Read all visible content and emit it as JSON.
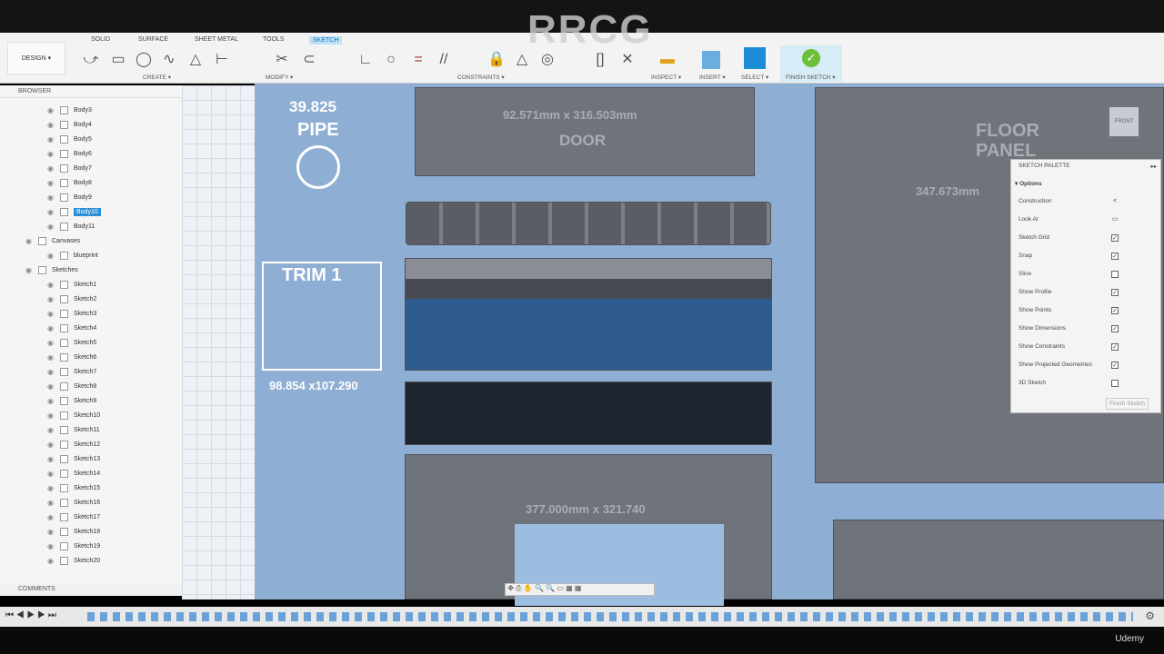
{
  "watermark": "RRCG",
  "toolbar": {
    "design": "DESIGN ▾",
    "tabs": [
      "SOLID",
      "SURFACE",
      "SHEET METAL",
      "TOOLS",
      "SKETCH"
    ],
    "groups": {
      "create": "CREATE ▾",
      "modify": "MODIFY ▾",
      "constraints": "CONSTRAINTS ▾",
      "inspect": "INSPECT ▾",
      "insert": "INSERT ▾",
      "select": "SELECT ▾",
      "finish": "FINISH SKETCH ▾"
    }
  },
  "browser": {
    "title": "BROWSER",
    "items": [
      "Body3",
      "Body4",
      "Body5",
      "Body6",
      "Body7",
      "Body8",
      "Body9",
      "Body10",
      "Body11",
      "Canvases",
      "blueprint",
      "Sketches",
      "Sketch1",
      "Sketch2",
      "Sketch3",
      "Sketch4",
      "Sketch5",
      "Sketch6",
      "Sketch7",
      "Sketch8",
      "Sketch9",
      "Sketch10",
      "Sketch11",
      "Sketch12",
      "Sketch13",
      "Sketch14",
      "Sketch15",
      "Sketch16",
      "Sketch17",
      "Sketch18",
      "Sketch19",
      "Sketch20"
    ],
    "selected": "Body10"
  },
  "comments": "COMMENTS",
  "blueprint": {
    "pipe_value": "39.825",
    "pipe": "PIPE",
    "trim": "TRIM 1",
    "trim_dim": "98.854 x107.290",
    "door_dim": "92.571mm x 316.503mm",
    "door": "DOOR",
    "floor": "FLOOR",
    "panel": "PANEL",
    "floor_dim": "347.673mm",
    "bottom_dim": "377.000mm x 321.740"
  },
  "palette": {
    "title": "SKETCH PALETTE",
    "section": "Options",
    "options": [
      {
        "label": "Construction",
        "type": "icon"
      },
      {
        "label": "Look At",
        "type": "icon"
      },
      {
        "label": "Sketch Grid",
        "checked": true
      },
      {
        "label": "Snap",
        "checked": true
      },
      {
        "label": "Slice",
        "checked": false
      },
      {
        "label": "Show Profile",
        "checked": true
      },
      {
        "label": "Show Points",
        "checked": true
      },
      {
        "label": "Show Dimensions",
        "checked": true
      },
      {
        "label": "Show Constraints",
        "checked": true
      },
      {
        "label": "Show Projected Geometries",
        "checked": true
      },
      {
        "label": "3D Sketch",
        "checked": false
      }
    ],
    "finish": "Finish Sketch"
  },
  "viewcube": "FRONT",
  "udemy": "Udemy"
}
